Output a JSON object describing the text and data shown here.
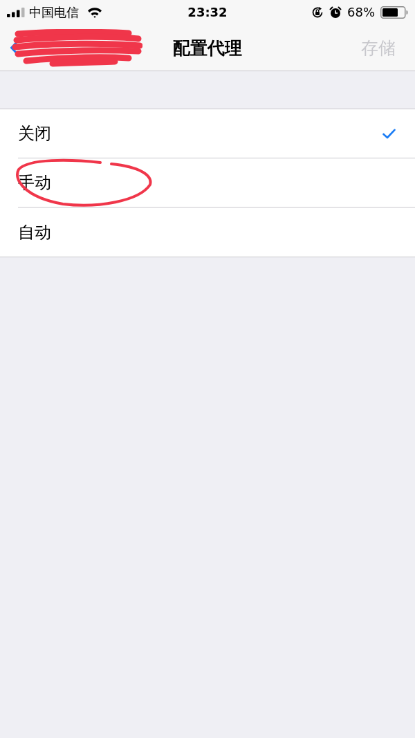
{
  "status_bar": {
    "carrier": "中国电信",
    "time": "23:32",
    "battery": "68%"
  },
  "nav_bar": {
    "back_button": {
      "scribbled_out": true
    },
    "title": "配置代理",
    "action": {
      "label": "存储",
      "disabled": true
    }
  },
  "options": [
    {
      "label": "关闭",
      "selected": true,
      "circled": false
    },
    {
      "label": "手动",
      "selected": false,
      "circled": true
    },
    {
      "label": "自动",
      "selected": false,
      "circled": false
    }
  ]
}
